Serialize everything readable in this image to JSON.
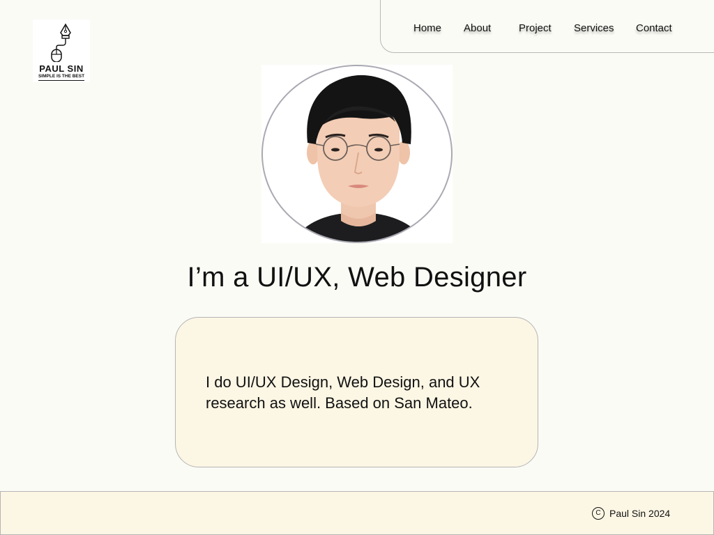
{
  "brand": {
    "name": "PAUL SIN",
    "tagline": "SIMPLE IS THE BEST",
    "logo_icon": "pen-nib-mouse-icon"
  },
  "nav": {
    "items": [
      "Home",
      "About",
      "Project",
      "Services",
      "Contact"
    ]
  },
  "hero": {
    "portrait_icon": "profile-photo",
    "headline": "I’m a UI/UX, Web Designer",
    "intro": "I do UI/UX Design, Web Design, and UX research as well. Based on San Mateo."
  },
  "footer": {
    "copyright_symbol": "C",
    "copyright_text": "Paul Sin 2024"
  },
  "colors": {
    "background": "#fafbf5",
    "card": "#fcf6e4",
    "border": "#b5b5b5",
    "text": "#111111"
  }
}
